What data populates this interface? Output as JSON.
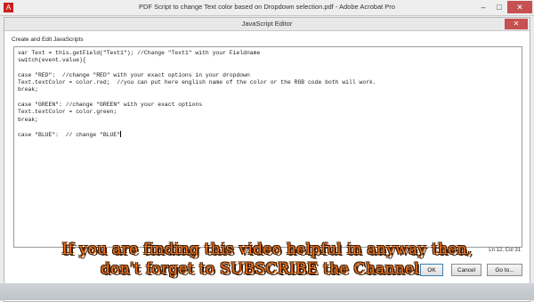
{
  "window": {
    "title": "PDF Script to change Text color based on Dropdown selection.pdf - Adobe Acrobat Pro",
    "controls": {
      "minimize": "–",
      "maximize": "□",
      "close": "✕"
    }
  },
  "dialog": {
    "title": "JavaScript Editor",
    "section_label": "Create and Edit JavaScripts",
    "close": "✕",
    "status": "Ln 12, Col 31",
    "buttons": {
      "ok": "OK",
      "cancel": "Cancel",
      "goto": "Go to..."
    }
  },
  "code": {
    "lines": [
      "var Text = this.getField(\"Text1\"); //Change \"Text1\" with your Fieldname",
      "switch(event.value){",
      "",
      "case \"RED\":  //change \"RED\" with your exact options in your dropdown",
      "Text.textColor = color.red;  //you can put here english name of the color or the RGB code both will work.",
      "break;",
      "",
      "case \"GREEN\": //change \"GREEN\" with your exact options",
      "Text.textColor = color.green;",
      "break;",
      "",
      "case \"BLUE\":  // change \"BLUE\""
    ]
  },
  "overlay": {
    "line1": "If you are finding this video helpful in anyway then,",
    "line2": "don't forget to SUBSCRIBE the Channel"
  },
  "colors": {
    "overlay_text": "#f2731c",
    "close_button": "#c75050"
  }
}
